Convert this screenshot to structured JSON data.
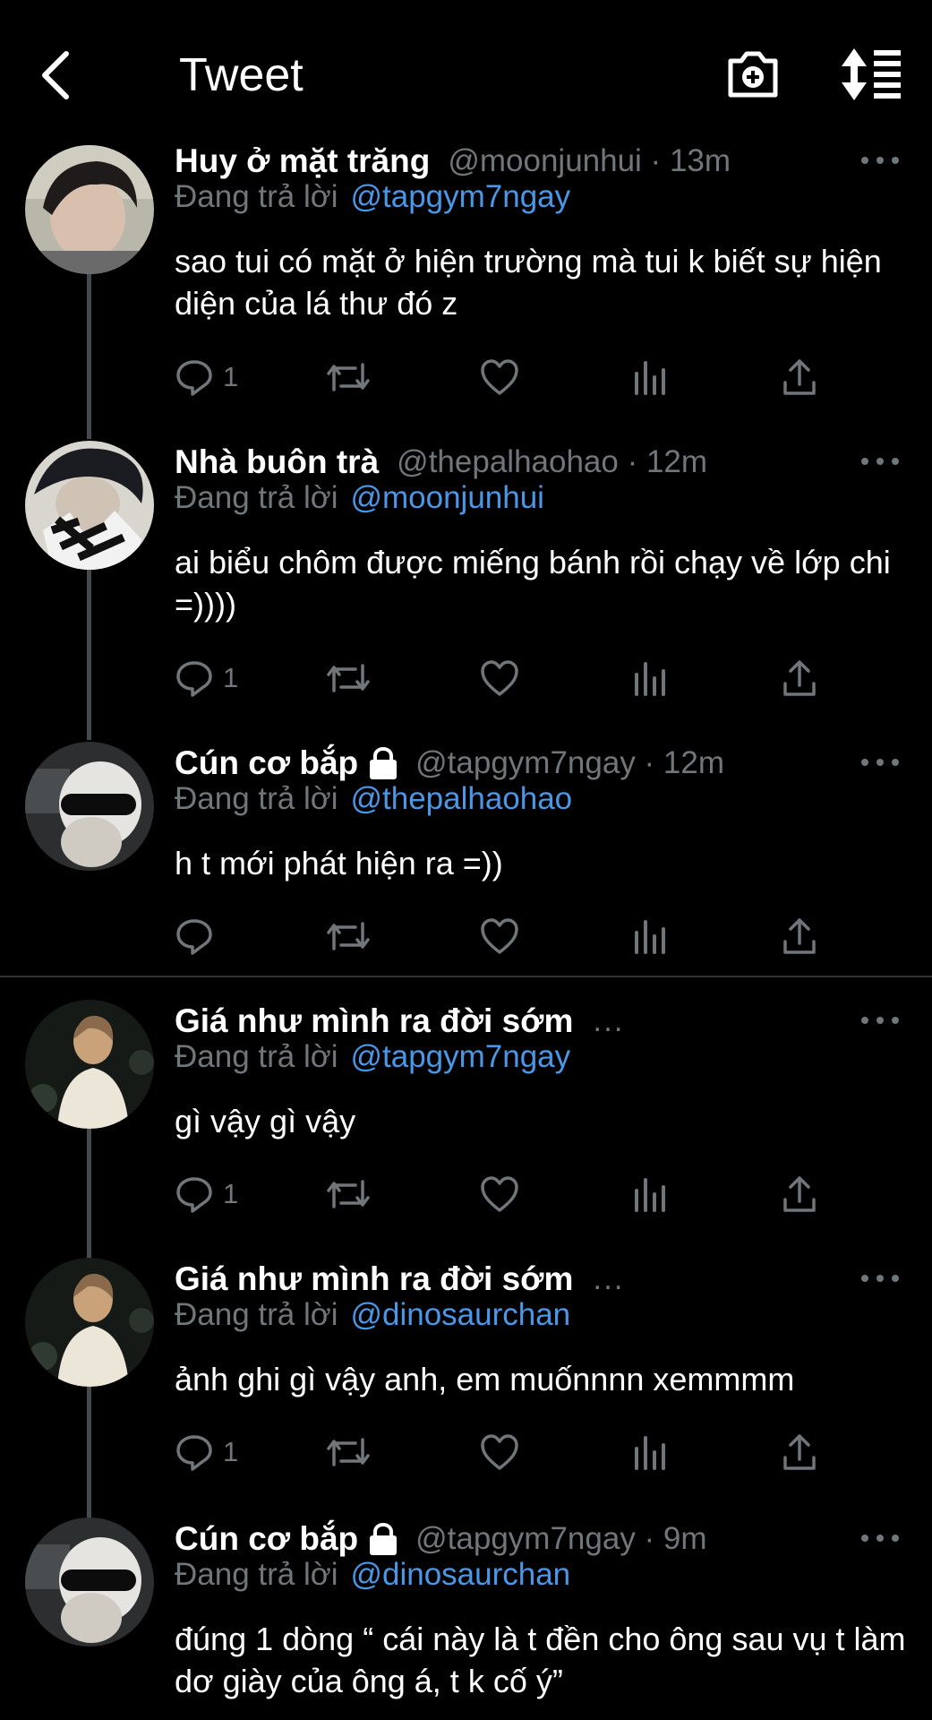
{
  "header": {
    "title": "Tweet",
    "back_icon": "chevron-left-icon",
    "camera_icon": "camera-plus-icon",
    "sort_icon": "sort-icon"
  },
  "colors": {
    "background": "#000000",
    "text": "#ffffff",
    "muted": "#71767b",
    "mention": "#4a97e8",
    "thread_line": "#444a4f"
  },
  "reply_prefix": "Đang trả lời",
  "tweets": [
    {
      "name": "Huy ở mặt trăng",
      "handle": "@moonjunhui · 13m",
      "reply_to": "@tapgym7ngay",
      "text": "sao tui có mặt ở hiện trường mà tui k biết sự hiện diện của lá thư đó z",
      "reply_count": "1",
      "locked": false
    },
    {
      "name": "Nhà buôn trà",
      "handle": "@thepalhaohao · 12m",
      "reply_to": "@moonjunhui",
      "text": "ai biểu chôm được miếng bánh rồi chạy về lớp chi =))))",
      "reply_count": "1",
      "locked": false
    },
    {
      "name": "Cún cơ bắp",
      "handle": "@tapgym7ngay · 12m",
      "reply_to": "@thepalhaohao",
      "text": "h t mới phát hiện ra =))",
      "reply_count": "",
      "locked": true
    },
    {
      "name": "Giá như mình ra đời sớm",
      "handle": "...",
      "reply_to": "@tapgym7ngay",
      "text": "gì vậy gì vậy",
      "reply_count": "1",
      "locked": false
    },
    {
      "name": "Giá như mình ra đời sớm",
      "handle": "...",
      "reply_to": "@dinosaurchan",
      "text": "ảnh ghi gì vậy anh, em muốnnnn xemmmm",
      "reply_count": "1",
      "locked": false
    },
    {
      "name": "Cún cơ bắp",
      "handle": "@tapgym7ngay · 9m",
      "reply_to": "@dinosaurchan",
      "text": "đúng 1 dòng “ cái này là t đền cho ông sau vụ t làm dơ giày của ông á, t k cố ý”",
      "reply_count": "",
      "locked": true
    }
  ]
}
